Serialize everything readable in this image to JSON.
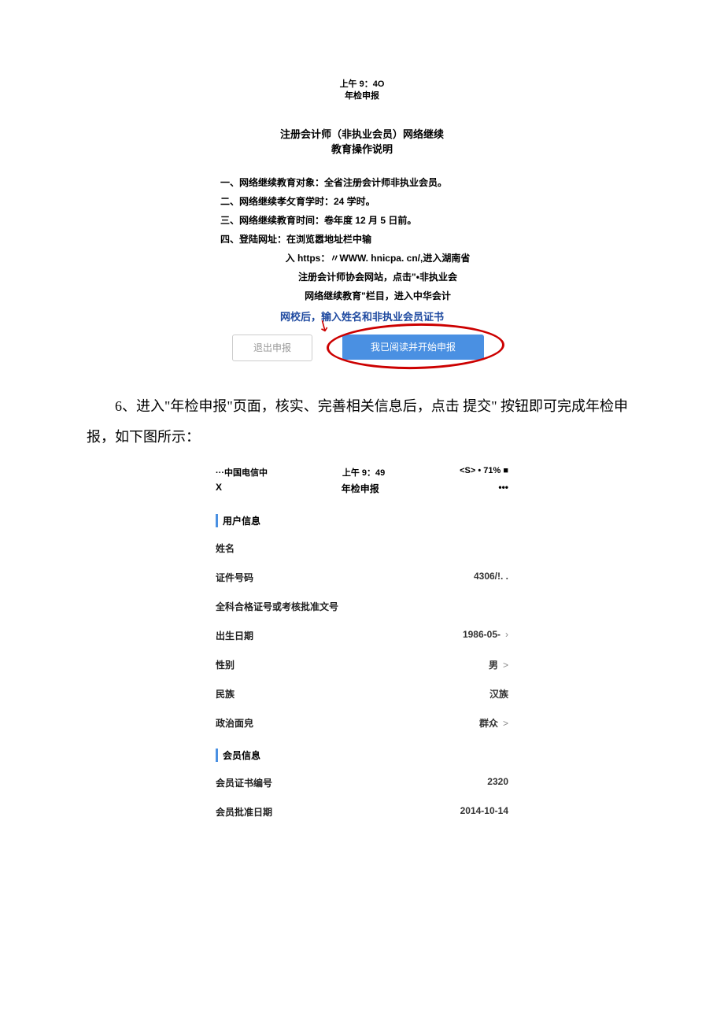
{
  "shot1": {
    "time": "上午 9：4O",
    "header": "年检申报",
    "title_l1": "注册会计师（非执业会员）网络继续",
    "title_l2": "教育操作说明",
    "i1": "一、网络继续教育对象：全省注册会计师非执业会员。",
    "i2": "二、网络继续孝攵育学时：24 学时。",
    "i3": "三、网络继续教育时间：卷年度 12 月 5 日前。",
    "i4": "四、登陆网址：在浏览嚣地址栏中输",
    "i4a": "入 https：〃WWW. hnicpa. cn/,进入湖南省",
    "i4b": "注册会计师协会网站，点击\"•非执业会",
    "i4c": "网络继续教育\"栏目，进入中华会计",
    "i4d": "网校后，输入姓名和非执业会员证书",
    "exit_btn": "退出申报",
    "start_btn": "我已阅读并开始申报"
  },
  "body": {
    "para_full": "6、进入\"年检申报\"页面，核实、完善相关信息后，点击 提交\" 按钮即可完成年检申报，如下图所示："
  },
  "shot2": {
    "carrier": "···中国电信中",
    "time": "上午 9：49",
    "battery": "<S> • 71% ■",
    "close": "X",
    "header": "年检申报",
    "more": "•••",
    "sec1": "用户信息",
    "r_name_l": "姓名",
    "r_name_v": "",
    "r_id_l": "证件号码",
    "r_id_v": "4306/!. .",
    "r_cert_l": "全科合格证号或考核批准文号",
    "r_cert_v": "",
    "r_dob_l": "出生日期",
    "r_dob_v": "1986-05-",
    "r_sex_l": "性别",
    "r_sex_v": "男",
    "r_nation_l": "民族",
    "r_nation_v": "汉族",
    "r_pol_l": "政治面皃",
    "r_pol_v": "群众",
    "sec2": "会员信息",
    "r_memno_l": "会员证书编号",
    "r_memno_v": "2320",
    "r_memdate_l": "会员批准日期",
    "r_memdate_v": "2014-10-14"
  }
}
